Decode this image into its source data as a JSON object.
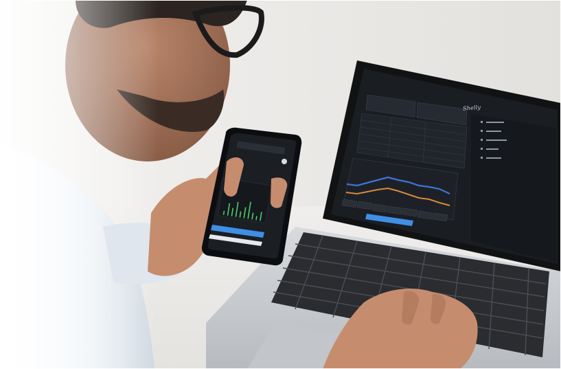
{
  "scene": {
    "description_free": true,
    "colors": {
      "wall": "#e9e7e5",
      "desk": "#ecebe9",
      "laptop_body": "#c9ccd0",
      "laptop_bezel": "#111214",
      "screen_bg": "#1a1d22",
      "chart_blue": "#3d74d6",
      "chart_orange": "#d98a3a",
      "phone_chart_green": "#4fcf6c",
      "accent_button": "#3f8fe6",
      "skin": "#c58d6e",
      "shirt": "#e6ebf0"
    }
  },
  "laptop_screen": {
    "brand": "Shelly"
  }
}
